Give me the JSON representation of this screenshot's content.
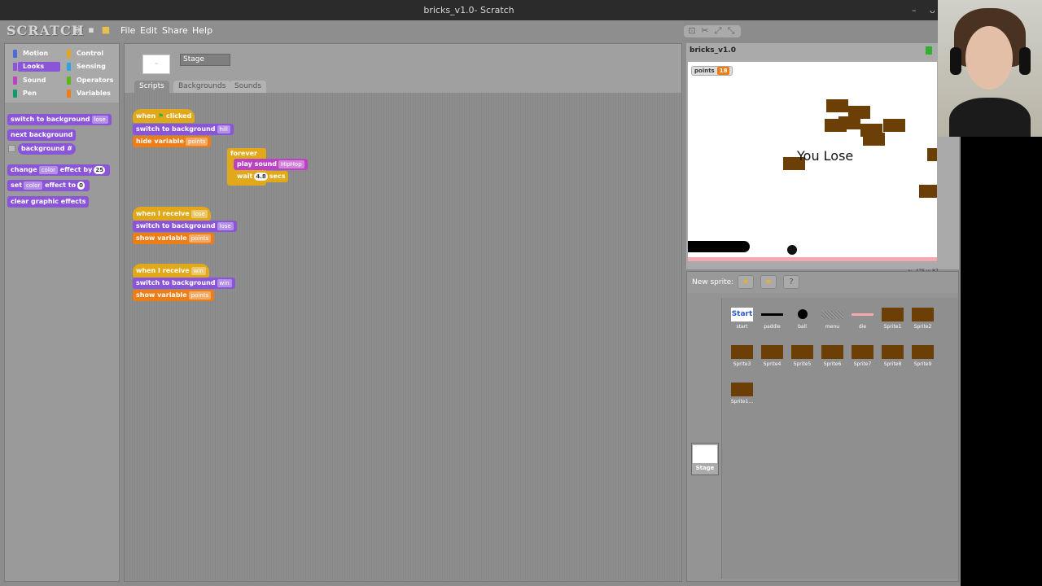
{
  "window": {
    "title": "bricks_v1.0- Scratch",
    "min": "–",
    "restore": "ᴗ"
  },
  "app": {
    "logo": "SCRATCH",
    "menu": [
      "File",
      "Edit",
      "Share",
      "Help"
    ]
  },
  "categories": [
    {
      "label": "Motion",
      "color": "#4a6cd4"
    },
    {
      "label": "Control",
      "color": "#e1a91a"
    },
    {
      "label": "Looks",
      "color": "#8a55d7"
    },
    {
      "label": "Sensing",
      "color": "#2ca5e2"
    },
    {
      "label": "Sound",
      "color": "#bb42c3"
    },
    {
      "label": "Operators",
      "color": "#5cb712"
    },
    {
      "label": "Pen",
      "color": "#0e9a6c"
    },
    {
      "label": "Variables",
      "color": "#ee7d16"
    }
  ],
  "palette": {
    "switch_bg": "switch to background",
    "switch_bg_opt": "lose",
    "next_bg": "next background",
    "bg_num": "background #",
    "change": "change",
    "color_opt": "color",
    "effect_by": "effect by",
    "effect_by_val": "25",
    "set": "set",
    "effect_to": "effect to",
    "effect_to_val": "0",
    "clear": "clear graphic effects"
  },
  "script_panel": {
    "sprite_name": "Stage",
    "tabs": [
      "Scripts",
      "Backgrounds",
      "Sounds"
    ],
    "thumb_text": "~"
  },
  "scripts": {
    "s1": {
      "hat_when": "when",
      "hat_clicked": "clicked",
      "switch": "switch to background",
      "switch_opt": "hill",
      "hide": "hide variable",
      "hide_opt": "points",
      "forever": "forever",
      "play": "play sound",
      "play_opt": "HipHop",
      "wait": "wait",
      "wait_val": "4.8",
      "secs": "secs"
    },
    "s2": {
      "hat": "when I receive",
      "hat_opt": "lose",
      "switch": "switch to background",
      "switch_opt": "lose",
      "show": "show variable",
      "show_opt": "points"
    },
    "s3": {
      "hat": "when I receive",
      "hat_opt": "win",
      "switch": "switch to background",
      "switch_opt": "win",
      "show": "show variable",
      "show_opt": "points"
    }
  },
  "stage": {
    "project_title": "bricks_v1.0",
    "watcher_label": "points",
    "watcher_value": "18",
    "message": "You Lose",
    "coords": "x: -475  y: 87"
  },
  "sprite_panel": {
    "new_sprite": "New sprite:",
    "buttons": [
      "★",
      "★",
      "?"
    ],
    "start_label": "Start",
    "stage_label": "Stage",
    "sprites": [
      "start",
      "paddle",
      "ball",
      "menu",
      "die",
      "Sprite1",
      "Sprite2",
      "Sprite3",
      "Sprite4",
      "Sprite5",
      "Sprite6",
      "Sprite7",
      "Sprite8",
      "Sprite9",
      "Sprite1..."
    ]
  }
}
